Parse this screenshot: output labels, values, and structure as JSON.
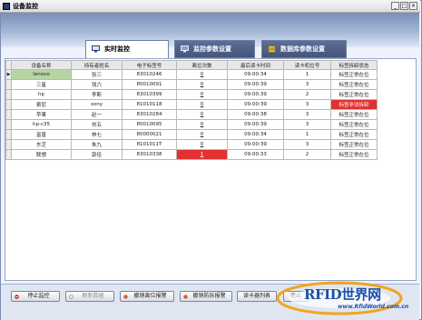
{
  "window": {
    "title": "设备监控"
  },
  "tabs": [
    {
      "label": "实时监控",
      "active": true
    },
    {
      "label": "监控参数设置",
      "active": false
    },
    {
      "label": "数据库参数设置",
      "active": false
    }
  ],
  "table": {
    "columns": [
      "设备名称",
      "持有者姓名",
      "电子标签号",
      "离位次数",
      "最后读卡时间",
      "读卡机位号",
      "标签拆卸状态"
    ],
    "rows": [
      {
        "device": "lenovo",
        "owner": "张三",
        "tag": "83010246",
        "count": "0",
        "time": "09:00:34",
        "reader": "1",
        "status": "标签正常在位",
        "selected": true,
        "count_alert": false,
        "status_alert": false
      },
      {
        "device": "三星",
        "owner": "钱六",
        "tag": "80010091",
        "count": "0",
        "time": "09:00:39",
        "reader": "3",
        "status": "标签正常在位",
        "selected": false,
        "count_alert": false,
        "status_alert": false
      },
      {
        "device": "hp",
        "owner": "李斯",
        "tag": "83010399",
        "count": "0",
        "time": "09:00:39",
        "reader": "2",
        "status": "标签正常在位",
        "selected": false,
        "count_alert": false,
        "status_alert": false
      },
      {
        "device": "索尼",
        "owner": "sony",
        "tag": "81010118",
        "count": "0",
        "time": "09:00:39",
        "reader": "3",
        "status": "标签非法拆卸",
        "selected": false,
        "count_alert": false,
        "status_alert": true
      },
      {
        "device": "苹果",
        "owner": "赵一",
        "tag": "83010284",
        "count": "0",
        "time": "09:00:38",
        "reader": "3",
        "status": "标签正常在位",
        "selected": false,
        "count_alert": false,
        "status_alert": false
      },
      {
        "device": "hp-c35",
        "owner": "刘五",
        "tag": "80010095",
        "count": "0",
        "time": "09:00:39",
        "reader": "3",
        "status": "标签正常在位",
        "selected": false,
        "count_alert": false,
        "status_alert": false
      },
      {
        "device": "富普",
        "owner": "林七",
        "tag": "80000021",
        "count": "0",
        "time": "09:00:34",
        "reader": "1",
        "status": "标签正常在位",
        "selected": false,
        "count_alert": false,
        "status_alert": false
      },
      {
        "device": "东芝",
        "owner": "朱九",
        "tag": "8101011T",
        "count": "0",
        "time": "09:00:39",
        "reader": "3",
        "status": "标签正常在位",
        "selected": false,
        "count_alert": false,
        "status_alert": false
      },
      {
        "device": "联想",
        "owner": "郭佳",
        "tag": "83010338",
        "count": "1",
        "time": "09:00:33",
        "reader": "2",
        "status": "标签正常在位",
        "selected": false,
        "count_alert": true,
        "status_alert": false
      }
    ]
  },
  "buttons": {
    "stop": "停止监控",
    "refresh": "刷新数据",
    "cancel_off_alarm": "撤销离位报警",
    "cancel_remove_alarm": "撤销防拆报警",
    "reader_list": "读卡器列表",
    "exit": "退出"
  },
  "watermark": {
    "text": "RFID世界网",
    "url": "www.RfidWorld.com.cn"
  },
  "colors": {
    "alert": "#e23131",
    "selected_row": "#b7d4a4",
    "tab_inactive": "#44557a"
  }
}
